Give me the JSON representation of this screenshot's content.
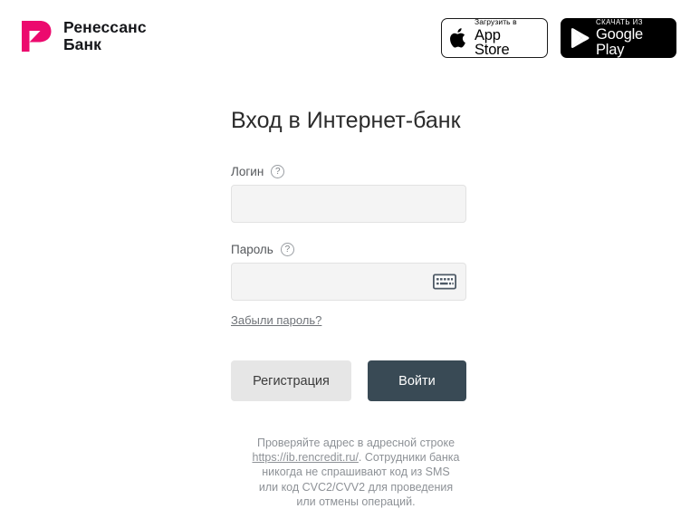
{
  "brand": {
    "logo_icon": "renaissance-leaf-p-logo",
    "name_line1": "Ренессанс",
    "name_line2": "Банк",
    "logo_color": "#EC0A6E",
    "text_color": "#15161A"
  },
  "header": {
    "app_store": {
      "icon": "apple-icon",
      "small_label": "Загрузить в",
      "big_label": "App Store",
      "background": "#FFFFFF",
      "foreground": "#000000"
    },
    "google_play": {
      "icon": "google-play-icon",
      "small_label": "СКАЧАТЬ ИЗ",
      "big_label": "Google Play",
      "background": "#000000",
      "foreground": "#FFFFFF"
    }
  },
  "form": {
    "title": "Вход в Интернет-банк",
    "login": {
      "label": "Логин",
      "help_icon": "question-mark-icon",
      "value": "",
      "placeholder": ""
    },
    "password": {
      "label": "Пароль",
      "help_icon": "question-mark-icon",
      "value": "",
      "placeholder": "",
      "keyboard_icon": "virtual-keyboard-icon"
    },
    "forgot_password_link": "Забыли пароль?",
    "register_button": "Регистрация",
    "submit_button": "Войти",
    "primary_color": "#394A55",
    "secondary_color": "#E6E6E6",
    "input_background": "#F4F4F4"
  },
  "footer": {
    "line1": "Проверяйте адрес в адресной строке",
    "link": "https://ib.rencredit.ru/",
    "line2_after_link": ". Сотрудники банка",
    "line3": "никогда не спрашивают код из SMS",
    "line4": "или код CVC2/CVV2 для проведения",
    "line5": "или отмены операций.",
    "text_color": "#8E9297"
  }
}
